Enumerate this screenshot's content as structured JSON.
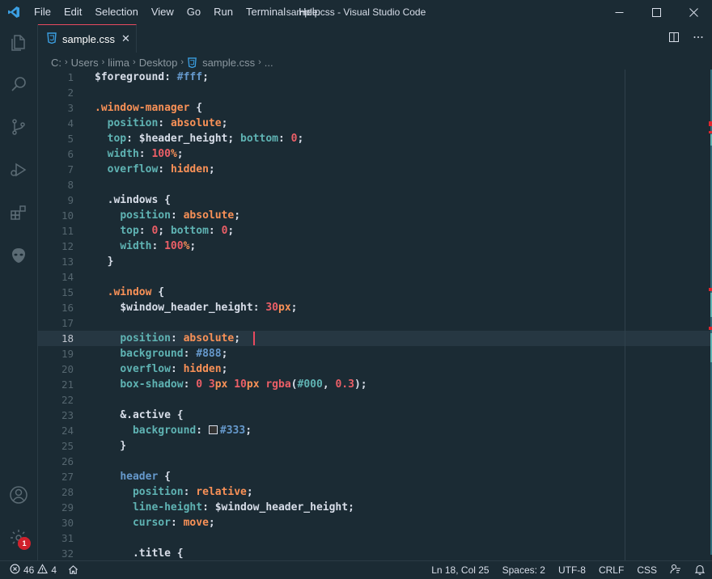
{
  "titlebar": {
    "menu": [
      "File",
      "Edit",
      "Selection",
      "View",
      "Go",
      "Run",
      "Terminal",
      "Help"
    ],
    "window_title": "sample.css - Visual Studio Code"
  },
  "activity": {
    "settings_badge": "1"
  },
  "tab": {
    "label": "sample.css"
  },
  "breadcrumb": [
    "C:",
    "Users",
    "liima",
    "Desktop",
    "sample.css",
    "..."
  ],
  "editor": {
    "cursor": {
      "line": 18,
      "col": 25
    },
    "lines": [
      {
        "n": "1",
        "tokens": [
          [
            "t-var",
            "$foreground"
          ],
          [
            "t-pun",
            ": "
          ],
          [
            "t-hex",
            "#fff"
          ],
          [
            "t-pun",
            ";"
          ]
        ]
      },
      {
        "n": "2",
        "tokens": []
      },
      {
        "n": "3",
        "tokens": [
          [
            "t-sel",
            ".window-manager"
          ],
          [
            "t-pun",
            " {"
          ]
        ]
      },
      {
        "n": "4",
        "tokens": [
          [
            "t-pun",
            "  "
          ],
          [
            "t-prop",
            "position"
          ],
          [
            "t-pun",
            ": "
          ],
          [
            "t-val",
            "absolute"
          ],
          [
            "t-pun",
            ";"
          ]
        ]
      },
      {
        "n": "5",
        "tokens": [
          [
            "t-pun",
            "  "
          ],
          [
            "t-prop",
            "top"
          ],
          [
            "t-pun",
            ": "
          ],
          [
            "t-var",
            "$header_height"
          ],
          [
            "t-pun",
            "; "
          ],
          [
            "t-prop",
            "bottom"
          ],
          [
            "t-pun",
            ": "
          ],
          [
            "t-num",
            "0"
          ],
          [
            "t-pun",
            ";"
          ]
        ]
      },
      {
        "n": "6",
        "tokens": [
          [
            "t-pun",
            "  "
          ],
          [
            "t-prop",
            "width"
          ],
          [
            "t-pun",
            ": "
          ],
          [
            "t-num",
            "100"
          ],
          [
            "t-val",
            "%"
          ],
          [
            "t-pun",
            ";"
          ]
        ]
      },
      {
        "n": "7",
        "tokens": [
          [
            "t-pun",
            "  "
          ],
          [
            "t-prop",
            "overflow"
          ],
          [
            "t-pun",
            ": "
          ],
          [
            "t-val",
            "hidden"
          ],
          [
            "t-pun",
            ";"
          ]
        ]
      },
      {
        "n": "8",
        "tokens": []
      },
      {
        "n": "9",
        "tokens": [
          [
            "t-pun",
            "  "
          ],
          [
            "t-selb",
            ".windows"
          ],
          [
            "t-pun",
            " {"
          ]
        ]
      },
      {
        "n": "10",
        "tokens": [
          [
            "t-pun",
            "    "
          ],
          [
            "t-prop",
            "position"
          ],
          [
            "t-pun",
            ": "
          ],
          [
            "t-val",
            "absolute"
          ],
          [
            "t-pun",
            ";"
          ]
        ]
      },
      {
        "n": "11",
        "tokens": [
          [
            "t-pun",
            "    "
          ],
          [
            "t-prop",
            "top"
          ],
          [
            "t-pun",
            ": "
          ],
          [
            "t-num",
            "0"
          ],
          [
            "t-pun",
            "; "
          ],
          [
            "t-prop",
            "bottom"
          ],
          [
            "t-pun",
            ": "
          ],
          [
            "t-num",
            "0"
          ],
          [
            "t-pun",
            ";"
          ]
        ]
      },
      {
        "n": "12",
        "tokens": [
          [
            "t-pun",
            "    "
          ],
          [
            "t-prop",
            "width"
          ],
          [
            "t-pun",
            ": "
          ],
          [
            "t-num",
            "100"
          ],
          [
            "t-val",
            "%"
          ],
          [
            "t-pun",
            ";"
          ]
        ]
      },
      {
        "n": "13",
        "tokens": [
          [
            "t-pun",
            "  }"
          ]
        ]
      },
      {
        "n": "14",
        "tokens": []
      },
      {
        "n": "15",
        "tokens": [
          [
            "t-pun",
            "  "
          ],
          [
            "t-sel",
            ".window"
          ],
          [
            "t-pun",
            " {"
          ]
        ]
      },
      {
        "n": "16",
        "tokens": [
          [
            "t-pun",
            "    "
          ],
          [
            "t-var",
            "$window_header_height"
          ],
          [
            "t-pun",
            ": "
          ],
          [
            "t-num",
            "30"
          ],
          [
            "t-val",
            "px"
          ],
          [
            "t-pun",
            ";"
          ]
        ]
      },
      {
        "n": "17",
        "tokens": []
      },
      {
        "n": "18",
        "tokens": [
          [
            "t-pun",
            "    "
          ],
          [
            "t-prop",
            "position"
          ],
          [
            "t-pun",
            ": "
          ],
          [
            "t-val",
            "absolute"
          ],
          [
            "t-pun",
            ";"
          ]
        ]
      },
      {
        "n": "19",
        "tokens": [
          [
            "t-pun",
            "    "
          ],
          [
            "t-prop",
            "background"
          ],
          [
            "t-pun",
            ": "
          ],
          [
            "t-hex",
            "#888"
          ],
          [
            "t-pun",
            ";"
          ]
        ]
      },
      {
        "n": "20",
        "tokens": [
          [
            "t-pun",
            "    "
          ],
          [
            "t-prop",
            "overflow"
          ],
          [
            "t-pun",
            ": "
          ],
          [
            "t-val",
            "hidden"
          ],
          [
            "t-pun",
            ";"
          ]
        ]
      },
      {
        "n": "21",
        "tokens": [
          [
            "t-pun",
            "    "
          ],
          [
            "t-prop",
            "box-shadow"
          ],
          [
            "t-pun",
            ": "
          ],
          [
            "t-num",
            "0 3"
          ],
          [
            "t-val",
            "px "
          ],
          [
            "t-num",
            "10"
          ],
          [
            "t-val",
            "px "
          ],
          [
            "t-fn",
            "rgba"
          ],
          [
            "t-pun",
            "("
          ],
          [
            "t-prop",
            "#000"
          ],
          [
            "t-pun",
            ", "
          ],
          [
            "t-num",
            "0.3"
          ],
          [
            "t-pun",
            ");"
          ]
        ]
      },
      {
        "n": "22",
        "tokens": []
      },
      {
        "n": "23",
        "tokens": [
          [
            "t-pun",
            "    "
          ],
          [
            "t-selb",
            "&.active"
          ],
          [
            "t-pun",
            " {"
          ]
        ]
      },
      {
        "n": "24",
        "tokens": [
          [
            "t-pun",
            "      "
          ],
          [
            "t-prop",
            "background"
          ],
          [
            "t-pun",
            ": "
          ],
          [
            "swatch",
            ""
          ],
          [
            "t-hex",
            "#333"
          ],
          [
            "t-pun",
            ";"
          ]
        ]
      },
      {
        "n": "25",
        "tokens": [
          [
            "t-pun",
            "    }"
          ]
        ]
      },
      {
        "n": "26",
        "tokens": []
      },
      {
        "n": "27",
        "tokens": [
          [
            "t-pun",
            "    "
          ],
          [
            "t-tag",
            "header"
          ],
          [
            "t-pun",
            " {"
          ]
        ]
      },
      {
        "n": "28",
        "tokens": [
          [
            "t-pun",
            "      "
          ],
          [
            "t-prop",
            "position"
          ],
          [
            "t-pun",
            ": "
          ],
          [
            "t-val",
            "relative"
          ],
          [
            "t-pun",
            ";"
          ]
        ]
      },
      {
        "n": "29",
        "tokens": [
          [
            "t-pun",
            "      "
          ],
          [
            "t-prop",
            "line-height"
          ],
          [
            "t-pun",
            ": "
          ],
          [
            "t-var",
            "$window_header_height"
          ],
          [
            "t-pun",
            ";"
          ]
        ]
      },
      {
        "n": "30",
        "tokens": [
          [
            "t-pun",
            "      "
          ],
          [
            "t-prop",
            "cursor"
          ],
          [
            "t-pun",
            ": "
          ],
          [
            "t-val",
            "move"
          ],
          [
            "t-pun",
            ";"
          ]
        ]
      },
      {
        "n": "31",
        "tokens": []
      },
      {
        "n": "32",
        "tokens": [
          [
            "t-pun",
            "      "
          ],
          [
            "t-selb",
            ".title"
          ],
          [
            "t-pun",
            " {"
          ]
        ]
      }
    ]
  },
  "statusbar": {
    "errors": "46",
    "warnings": "4",
    "position": "Ln 18, Col 25",
    "spaces": "Spaces: 2",
    "encoding": "UTF-8",
    "eol": "CRLF",
    "language": "CSS"
  },
  "colors": {
    "background": "#1b2b34",
    "accent": "#e84a5f",
    "error": "#e0262e"
  }
}
